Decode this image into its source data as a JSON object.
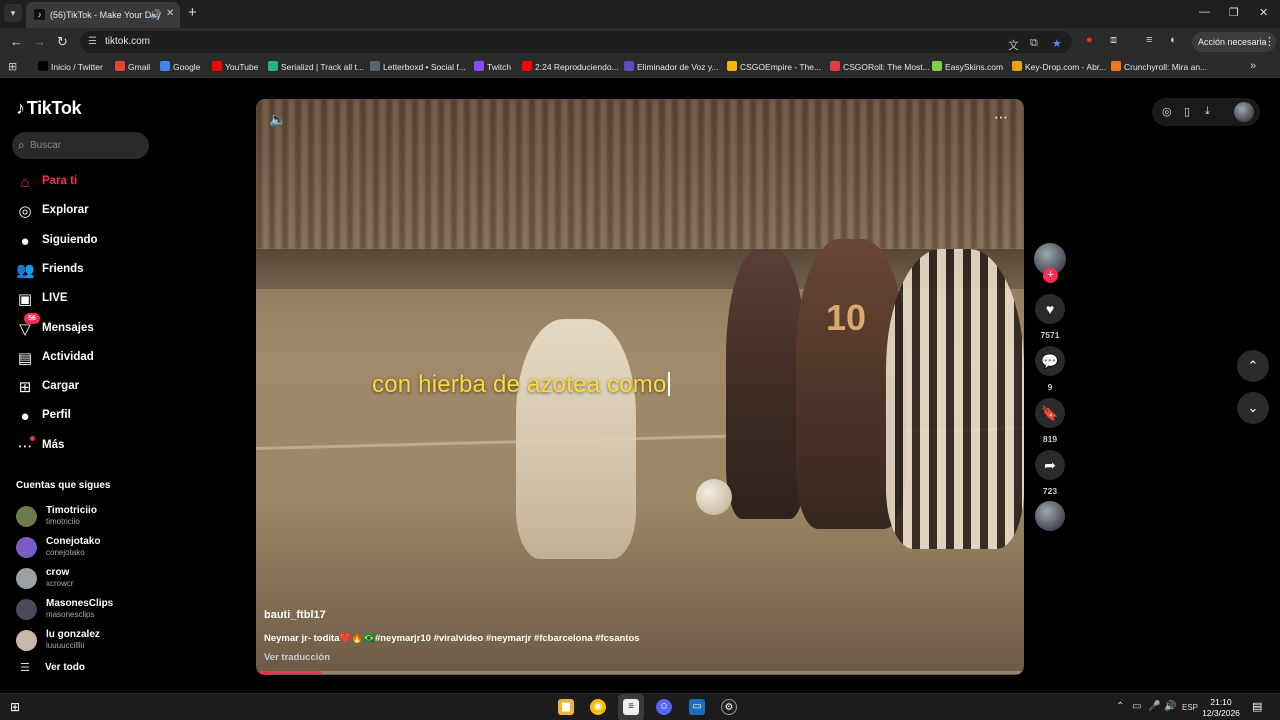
{
  "browser": {
    "tab": {
      "title": "(56)TikTok - Make Your Day",
      "favicon": "♪",
      "audio_icon": "🔊",
      "close_icon": "✕"
    },
    "new_tab_icon": "+",
    "window_controls": {
      "minimize": "—",
      "maximize": "❐",
      "close": "✕"
    },
    "url": "tiktok.com",
    "action_button": "Acción necesaria",
    "bookmarks": [
      {
        "label": "Inicio / Twitter",
        "color": "#000000"
      },
      {
        "label": "Gmail",
        "color": "#ea4335"
      },
      {
        "label": "Google",
        "color": "#4285f4"
      },
      {
        "label": "YouTube",
        "color": "#ff0000"
      },
      {
        "label": "Serializd | Track all t...",
        "color": "#22b573"
      },
      {
        "label": "Letterboxd • Social f...",
        "color": "#556677"
      },
      {
        "label": "Twitch",
        "color": "#9146ff"
      },
      {
        "label": "2:24 Reproduciendo...",
        "color": "#ff0000"
      },
      {
        "label": "Eliminador de Voz y...",
        "color": "#5b4cc4"
      },
      {
        "label": "CSGOEmpire - The...",
        "color": "#f5b301"
      },
      {
        "label": "CSGORoll: The Most...",
        "color": "#e23b3b"
      },
      {
        "label": "EasySkins.com",
        "color": "#7bd14b"
      },
      {
        "label": "Key-Drop.com - Abr...",
        "color": "#e8a400"
      },
      {
        "label": "Crunchyroll: Mira an...",
        "color": "#f47521"
      }
    ]
  },
  "tiktok": {
    "logo": "TikTok",
    "search_placeholder": "Buscar",
    "nav": [
      {
        "label": "Para ti",
        "icon": "⌂",
        "active": true
      },
      {
        "label": "Explorar",
        "icon": "◎"
      },
      {
        "label": "Siguiendo",
        "icon": "●"
      },
      {
        "label": "Friends",
        "icon": "👥"
      },
      {
        "label": "LIVE",
        "icon": "▣"
      },
      {
        "label": "Mensajes",
        "icon": "▽",
        "badge": "56"
      },
      {
        "label": "Actividad",
        "icon": "▤"
      },
      {
        "label": "Cargar",
        "icon": "⊞"
      },
      {
        "label": "Perfil",
        "icon": "●"
      },
      {
        "label": "Más",
        "icon": "⋯"
      }
    ],
    "following_title": "Cuentas que sigues",
    "accounts": [
      {
        "name": "Timotriciio",
        "handle": "timotriciio",
        "color": "#6b7a4a"
      },
      {
        "name": "Conejotako",
        "handle": "conejotako",
        "color": "#7a5cc4"
      },
      {
        "name": "crow",
        "handle": "xcrowcr",
        "color": "#9aa0a6"
      },
      {
        "name": "MasonesClips",
        "handle": "masonesclips",
        "color": "#4a4a5a"
      },
      {
        "name": "lu gonzalez",
        "handle": "luuuuccilllii",
        "color": "#c9b7a8"
      }
    ],
    "see_all": "Ver todo",
    "video": {
      "author": "bauti_ftbl17",
      "description": "Neymar jr- todita❤️🔥🇧🇷#neymarjr10 #viralvideo #neymarjr #fcbarcelona #fcsantos",
      "translate": "Ver traducción",
      "caption": "con hierba de azotea como",
      "jersey_number": "10",
      "progress": 0.085
    },
    "actions": {
      "likes": "7571",
      "comments": "9",
      "saves": "819",
      "shares": "723"
    }
  },
  "taskbar": {
    "language": "ESP",
    "time": "21:10",
    "date": "12/3/2026"
  }
}
